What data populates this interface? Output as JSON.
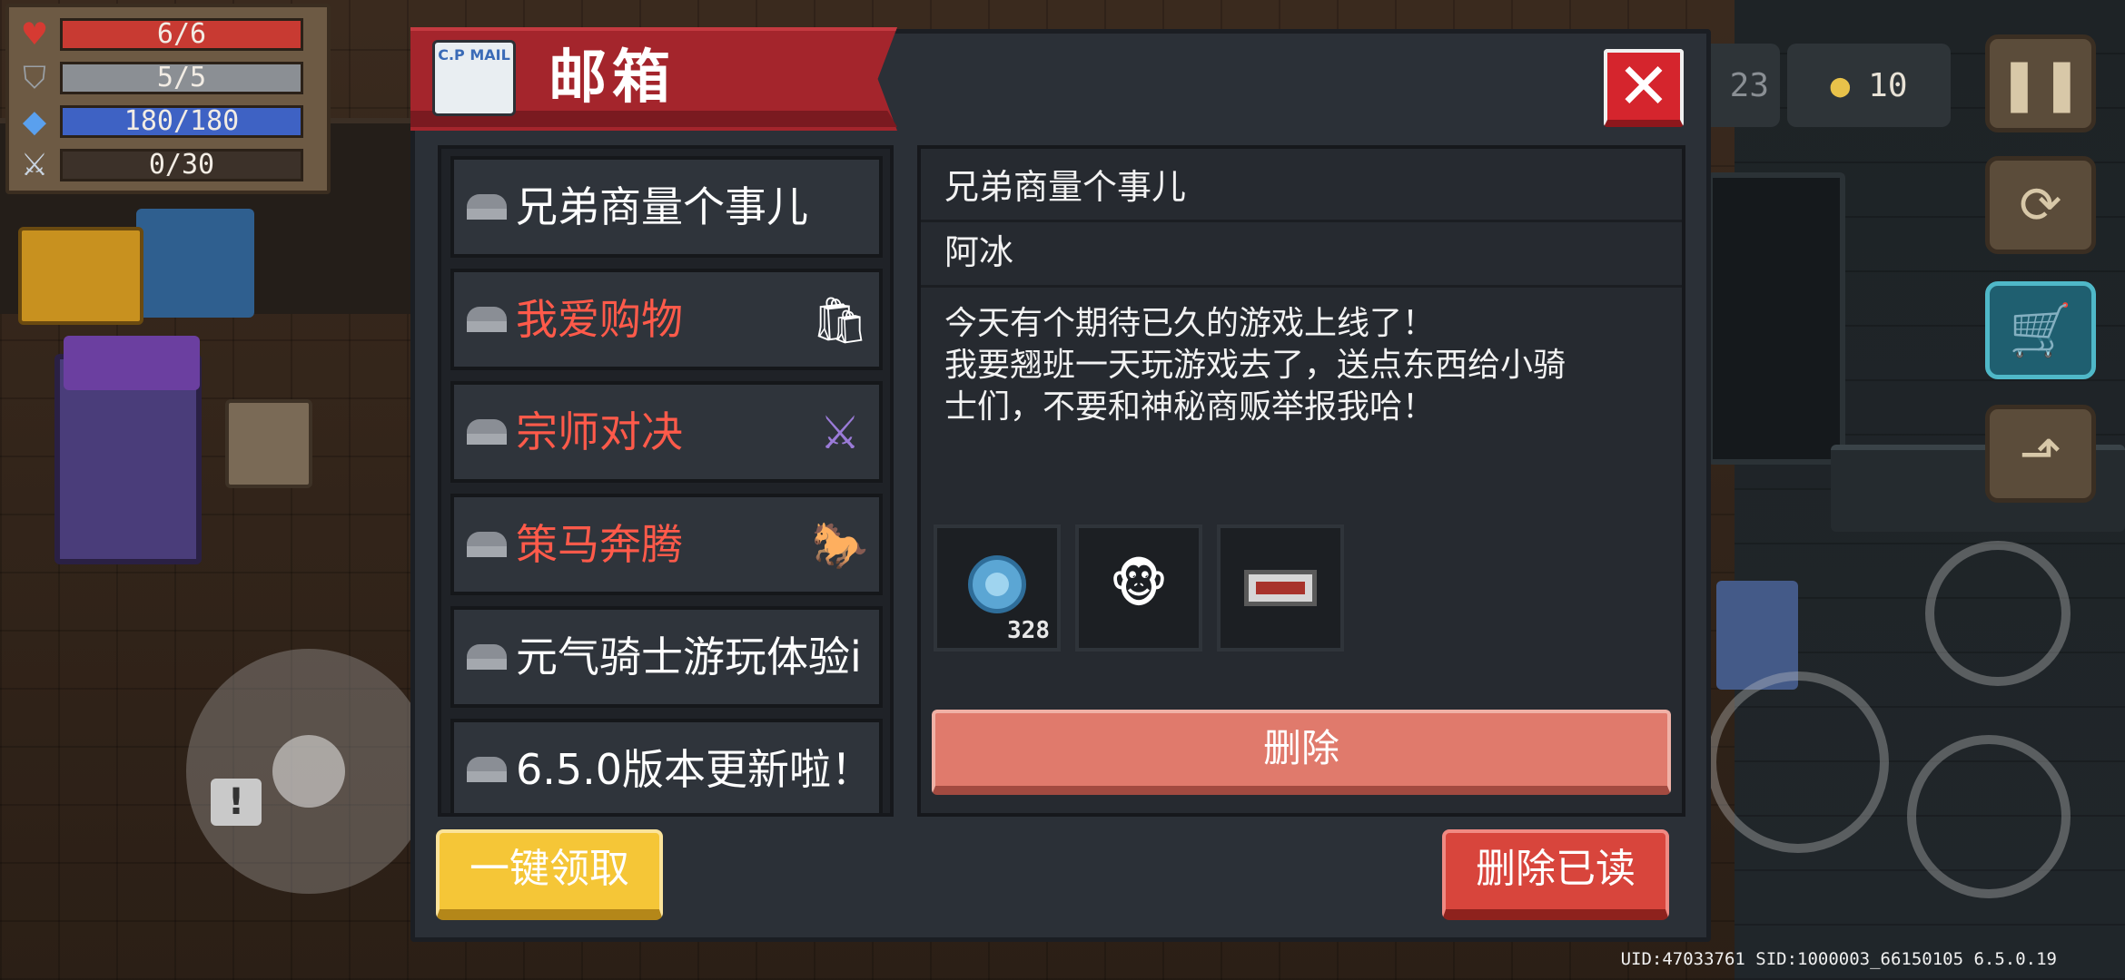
{
  "stats": {
    "hp": {
      "text": "6/6",
      "fill": 1.0,
      "color": "#c83a32",
      "icon": "heart-icon"
    },
    "armor": {
      "text": "5/5",
      "fill": 1.0,
      "color": "#8b8f94",
      "icon": "shield-icon"
    },
    "energy": {
      "text": "180/180",
      "fill": 1.0,
      "color": "#3e62c4",
      "icon": "diamond-icon"
    },
    "skill": {
      "text": "0/30",
      "fill": 0.0,
      "color": "#b87b2a",
      "icon": "sword-icon"
    }
  },
  "hud": {
    "partial_count": "23",
    "coins": "10"
  },
  "dialog": {
    "title": "邮箱",
    "logo_text": "C.P MAIL",
    "close_symbol": "✕"
  },
  "mail_list": [
    {
      "label": "兄弟商量个事儿",
      "unread": false
    },
    {
      "label": "我爱购物",
      "unread": true
    },
    {
      "label": "宗师对决",
      "unread": true
    },
    {
      "label": "策马奔腾",
      "unread": true
    },
    {
      "label": "元气骑士游玩体验i",
      "unread": false
    },
    {
      "label": "6.5.0版本更新啦！",
      "unread": false
    }
  ],
  "detail": {
    "title": "兄弟商量个事儿",
    "sender": "阿冰",
    "body": "今天有个期待已久的游戏上线了！\n我要翘班一天玩游戏去了，送点东西给小骑\n士们，不要和神秘商贩举报我哈！",
    "attachments": [
      {
        "icon": "gem-coin-icon",
        "count": "328"
      },
      {
        "icon": "monkey-pet-icon",
        "count": ""
      },
      {
        "icon": "ticket-icon",
        "count": ""
      }
    ],
    "delete_label": "删除"
  },
  "buttons": {
    "claim_all": "一键领取",
    "delete_read": "删除已读"
  },
  "footer": {
    "uid": "UID:47033761 SID:1000003_66150105 6.5.0.19"
  }
}
